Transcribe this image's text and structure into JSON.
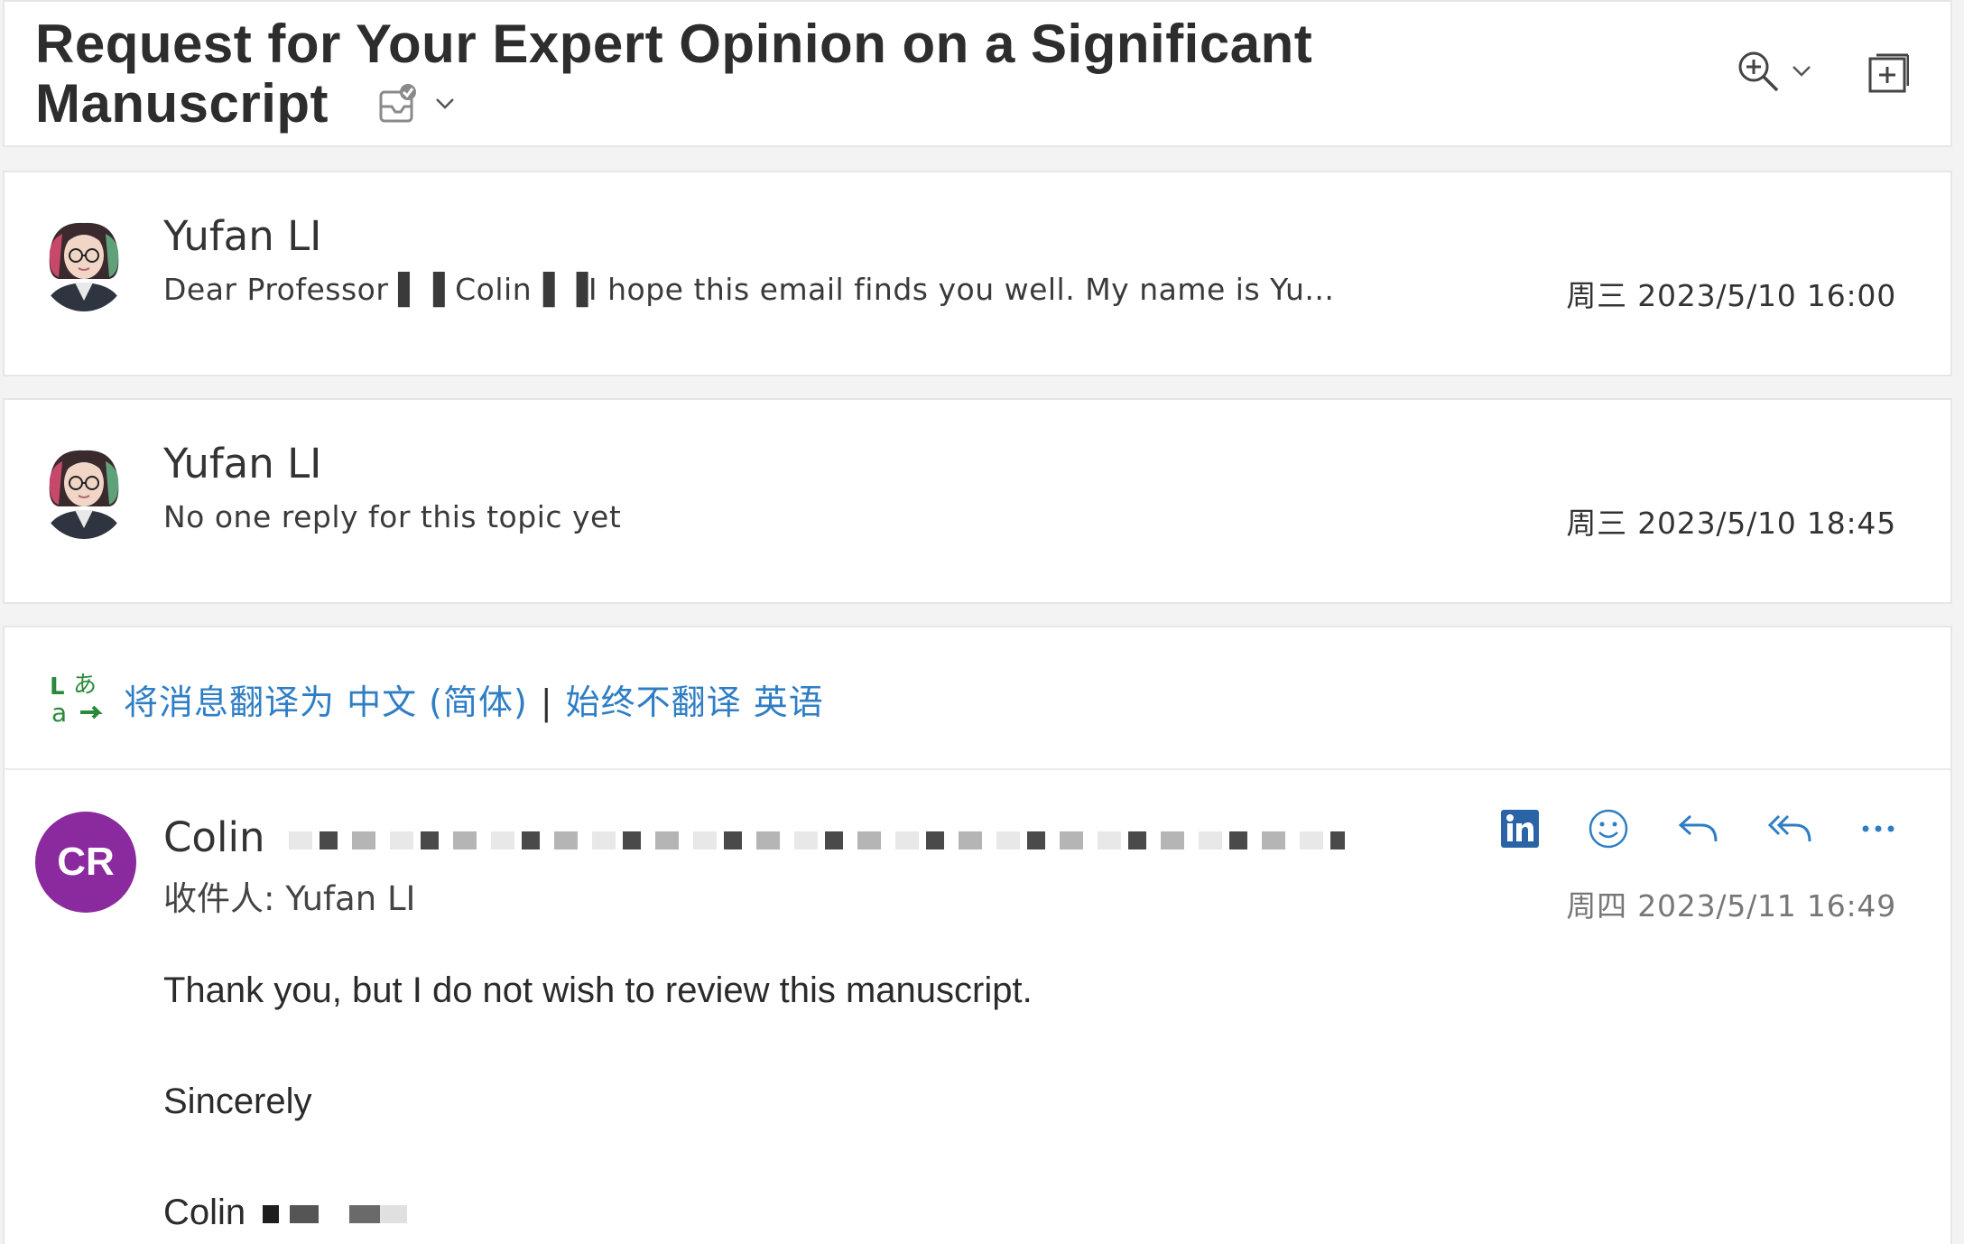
{
  "subject": {
    "line1": "Request for Your Expert Opinion on a Significant",
    "line2": "Manuscript"
  },
  "threads": [
    {
      "sender": "Yufan LI",
      "preview": "Dear Professor ▌▐ Colin▐ ▐I hope this email finds you well. My name is Yu...",
      "time": "周三 2023/5/10 16:00"
    },
    {
      "sender": "Yufan LI",
      "preview": "No one reply for this topic yet",
      "time": "周三 2023/5/10 18:45"
    }
  ],
  "translate": {
    "translate_label": "将消息翻译为 中文 (简体)",
    "separator": "|",
    "never_label": "始终不翻译 英语"
  },
  "message": {
    "avatar_initials": "CR",
    "from_name": "Colin",
    "recipient": "收件人:  Yufan LI",
    "time": "周四 2023/5/11 16:49",
    "body": {
      "line1": "Thank you, but I do not wish to review this manuscript.",
      "line2": "Sincerely",
      "line3": "Colin"
    },
    "colors": {
      "avatar_bg": "#8a2a9e",
      "link": "#2f7ec5",
      "linkedin": "#2a64a7",
      "translate_icon": "#2a8a3a"
    }
  }
}
